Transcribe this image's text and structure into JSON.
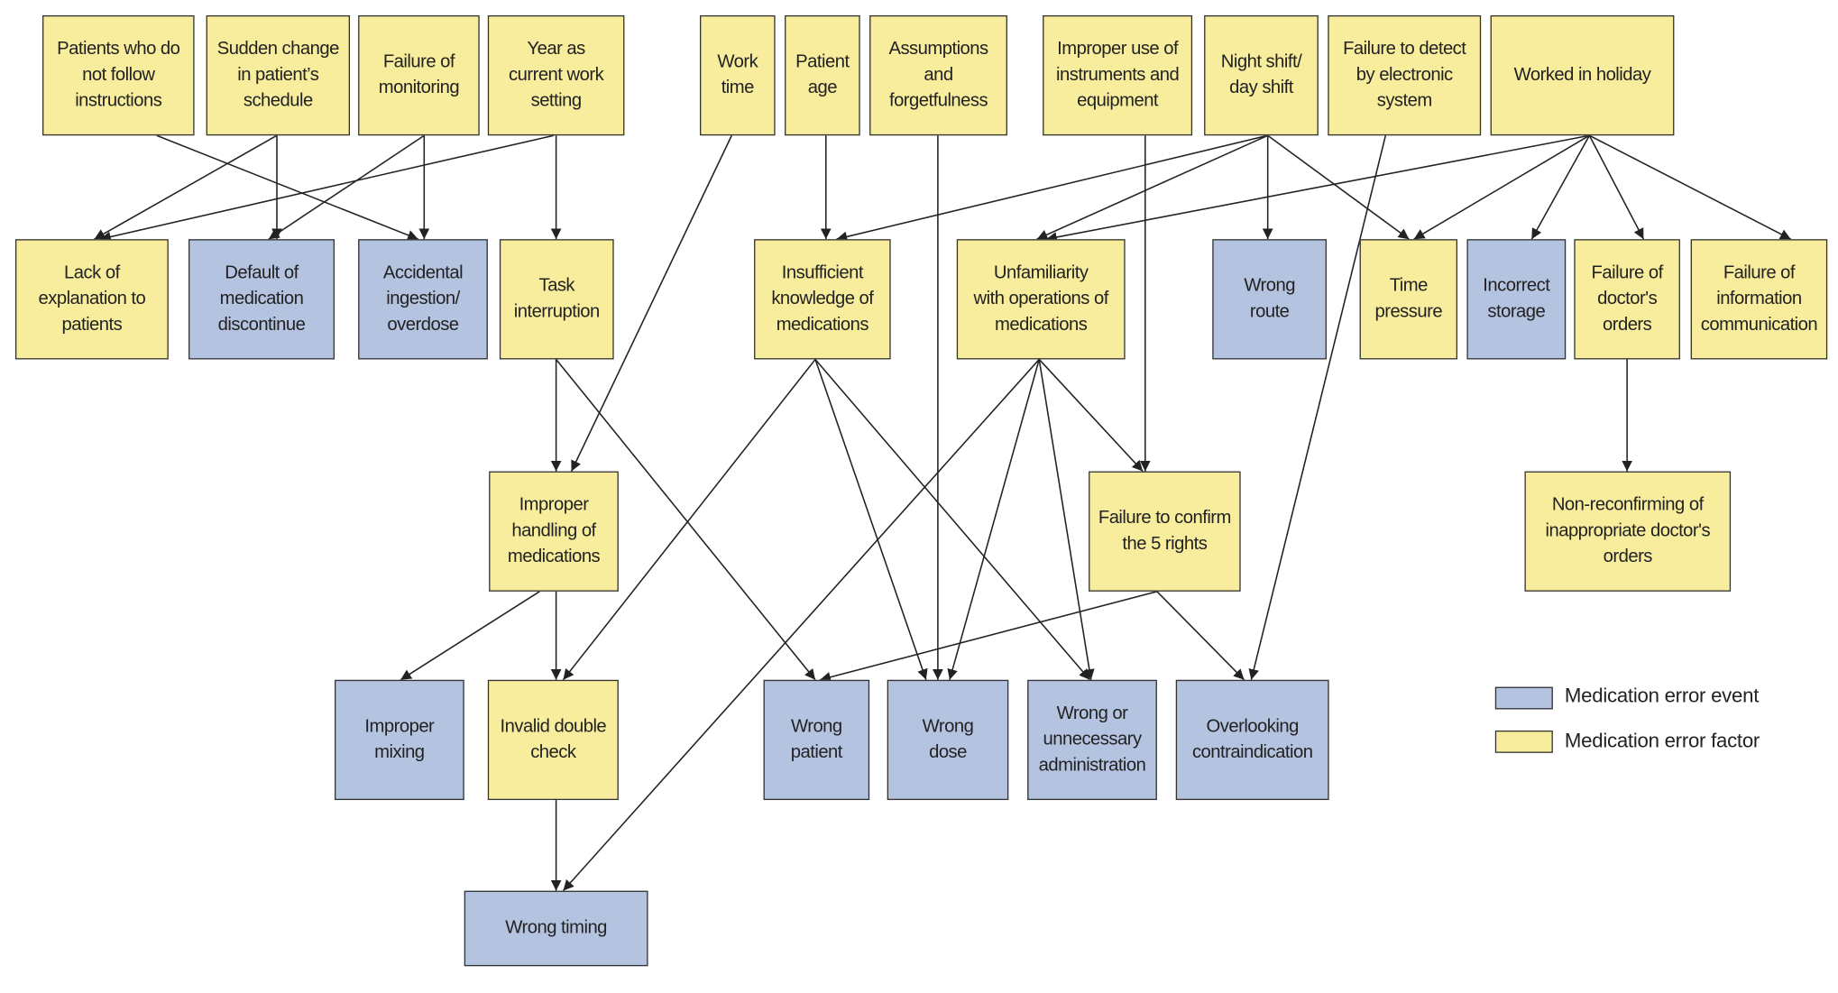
{
  "colors": {
    "factor": "#f7ed9c",
    "event": "#b4c3e0",
    "edge": "#222222"
  },
  "nodes": [
    {
      "id": "A",
      "label": "Patients who do\nnot follow\ninstructions",
      "type": "factor"
    },
    {
      "id": "B",
      "label": "Sudden change\nin patient’s\nschedule",
      "type": "factor"
    },
    {
      "id": "C",
      "label": "Failure of\nmonitoring",
      "type": "factor"
    },
    {
      "id": "D",
      "label": "Year as\ncurrent work\nsetting",
      "type": "factor"
    },
    {
      "id": "E",
      "label": "Work\ntime",
      "type": "factor"
    },
    {
      "id": "F",
      "label": "Patient\nage",
      "type": "factor"
    },
    {
      "id": "G",
      "label": "Assumptions\nand\nforgetfulness",
      "type": "factor"
    },
    {
      "id": "H",
      "label": "Improper use of\ninstruments and\nequipment",
      "type": "factor"
    },
    {
      "id": "I",
      "label": "Night shift/\nday shift",
      "type": "factor"
    },
    {
      "id": "J",
      "label": "Failure to detect\nby electronic\nsystem",
      "type": "factor"
    },
    {
      "id": "K",
      "label": "Worked in holiday",
      "type": "factor"
    },
    {
      "id": "L",
      "label": "Lack of\nexplanation to\npatients",
      "type": "factor"
    },
    {
      "id": "M",
      "label": "Default of\nmedication\ndiscontinue",
      "type": "event"
    },
    {
      "id": "N",
      "label": "Accidental\ningestion/\noverdose",
      "type": "event"
    },
    {
      "id": "O",
      "label": "Task\ninterruption",
      "type": "factor"
    },
    {
      "id": "P",
      "label": "Insufficient\nknowledge of\nmedications",
      "type": "factor"
    },
    {
      "id": "Q",
      "label": "Unfamiliarity\nwith operations of\nmedications",
      "type": "factor"
    },
    {
      "id": "R",
      "label": "Wrong\nroute",
      "type": "event"
    },
    {
      "id": "S",
      "label": "Time\npressure",
      "type": "factor"
    },
    {
      "id": "T",
      "label": "Incorrect\nstorage",
      "type": "event"
    },
    {
      "id": "U",
      "label": "Failure of\ndoctor's\norders",
      "type": "factor"
    },
    {
      "id": "V",
      "label": "Failure of\ninformation\ncommunication",
      "type": "factor"
    },
    {
      "id": "W",
      "label": "Improper\nhandling of\nmedications",
      "type": "factor"
    },
    {
      "id": "X",
      "label": "Failure to confirm\nthe 5 rights",
      "type": "factor"
    },
    {
      "id": "Y",
      "label": "Non-reconfirming of\ninappropriate doctor's\norders",
      "type": "factor"
    },
    {
      "id": "Z",
      "label": "Improper\nmixing",
      "type": "event"
    },
    {
      "id": "AA",
      "label": "Invalid double\ncheck",
      "type": "factor"
    },
    {
      "id": "AB",
      "label": "Wrong\npatient",
      "type": "event"
    },
    {
      "id": "AC",
      "label": "Wrong\ndose",
      "type": "event"
    },
    {
      "id": "AD",
      "label": "Wrong or\nunnecessary\nadministration",
      "type": "event"
    },
    {
      "id": "AE",
      "label": "Overlooking\ncontraindication",
      "type": "event"
    },
    {
      "id": "AF",
      "label": "Wrong timing",
      "type": "event"
    }
  ],
  "edges": [
    [
      "A",
      "N"
    ],
    [
      "B",
      "L"
    ],
    [
      "B",
      "M"
    ],
    [
      "C",
      "M"
    ],
    [
      "C",
      "N"
    ],
    [
      "D",
      "L"
    ],
    [
      "D",
      "O"
    ],
    [
      "E",
      "W"
    ],
    [
      "F",
      "P"
    ],
    [
      "G",
      "AC"
    ],
    [
      "H",
      "X"
    ],
    [
      "I",
      "P"
    ],
    [
      "I",
      "Q"
    ],
    [
      "I",
      "R"
    ],
    [
      "I",
      "S"
    ],
    [
      "J",
      "AE"
    ],
    [
      "K",
      "Q"
    ],
    [
      "K",
      "S"
    ],
    [
      "K",
      "T"
    ],
    [
      "K",
      "U"
    ],
    [
      "K",
      "V"
    ],
    [
      "O",
      "W"
    ],
    [
      "O",
      "AB"
    ],
    [
      "P",
      "AA"
    ],
    [
      "P",
      "AC"
    ],
    [
      "P",
      "AD"
    ],
    [
      "Q",
      "AF"
    ],
    [
      "Q",
      "AC"
    ],
    [
      "Q",
      "AD"
    ],
    [
      "Q",
      "X"
    ],
    [
      "U",
      "Y"
    ],
    [
      "W",
      "Z"
    ],
    [
      "W",
      "AA"
    ],
    [
      "X",
      "AB"
    ],
    [
      "X",
      "AE"
    ],
    [
      "AA",
      "AF"
    ]
  ],
  "legend": [
    {
      "label": "Medication error event",
      "type": "event"
    },
    {
      "label": "Medication error factor",
      "type": "factor"
    }
  ]
}
